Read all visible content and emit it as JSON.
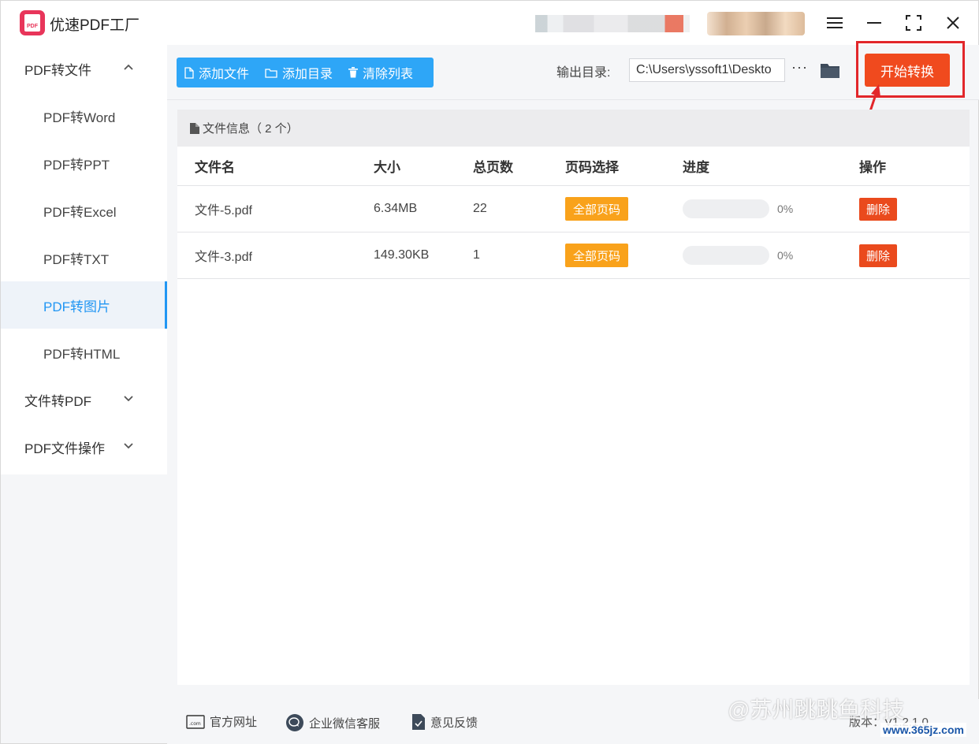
{
  "app": {
    "title": "优速PDF工厂",
    "logo_text": "PDF"
  },
  "window_controls": {
    "menu": "≡",
    "minimize": "—",
    "maximize": "⛶",
    "close": "✕"
  },
  "sidebar": {
    "groups": [
      {
        "label": "PDF转文件",
        "expanded": true,
        "items": [
          {
            "label": "PDF转Word"
          },
          {
            "label": "PDF转PPT"
          },
          {
            "label": "PDF转Excel"
          },
          {
            "label": "PDF转TXT"
          },
          {
            "label": "PDF转图片",
            "active": true
          },
          {
            "label": "PDF转HTML"
          }
        ]
      },
      {
        "label": "文件转PDF",
        "expanded": false
      },
      {
        "label": "PDF文件操作",
        "expanded": false
      }
    ]
  },
  "toolbar": {
    "add_file": "添加文件",
    "add_dir": "添加目录",
    "clear_list": "清除列表",
    "output_label": "输出目录:",
    "output_value": "C:\\Users\\yssoft1\\Deskto",
    "more": "···",
    "start_button": "开始转换"
  },
  "file_panel": {
    "info_label": "文件信息（ 2 个）",
    "columns": [
      "文件名",
      "大小",
      "总页数",
      "页码选择",
      "进度",
      "操作"
    ],
    "rows": [
      {
        "name": "文件-5.pdf",
        "size": "6.34MB",
        "pages": "22",
        "page_select": "全部页码",
        "progress": 0,
        "progress_text": "0%",
        "action": "删除"
      },
      {
        "name": "文件-3.pdf",
        "size": "149.30KB",
        "pages": "1",
        "page_select": "全部页码",
        "progress": 0,
        "progress_text": "0%",
        "action": "删除"
      }
    ]
  },
  "footer": {
    "website": "官方网址",
    "wechat": "企业微信客服",
    "feedback": "意见反馈",
    "version": "版本：V1.2.1.0",
    "watermark": "@苏州跳跳鱼科技",
    "site_mark": "www.365jz.com"
  },
  "colors": {
    "accent": "#2ea6f7",
    "start": "#f04a1e",
    "highlight": "#e2262a",
    "orange": "#f9a21b",
    "delete": "#ea4a1d"
  }
}
